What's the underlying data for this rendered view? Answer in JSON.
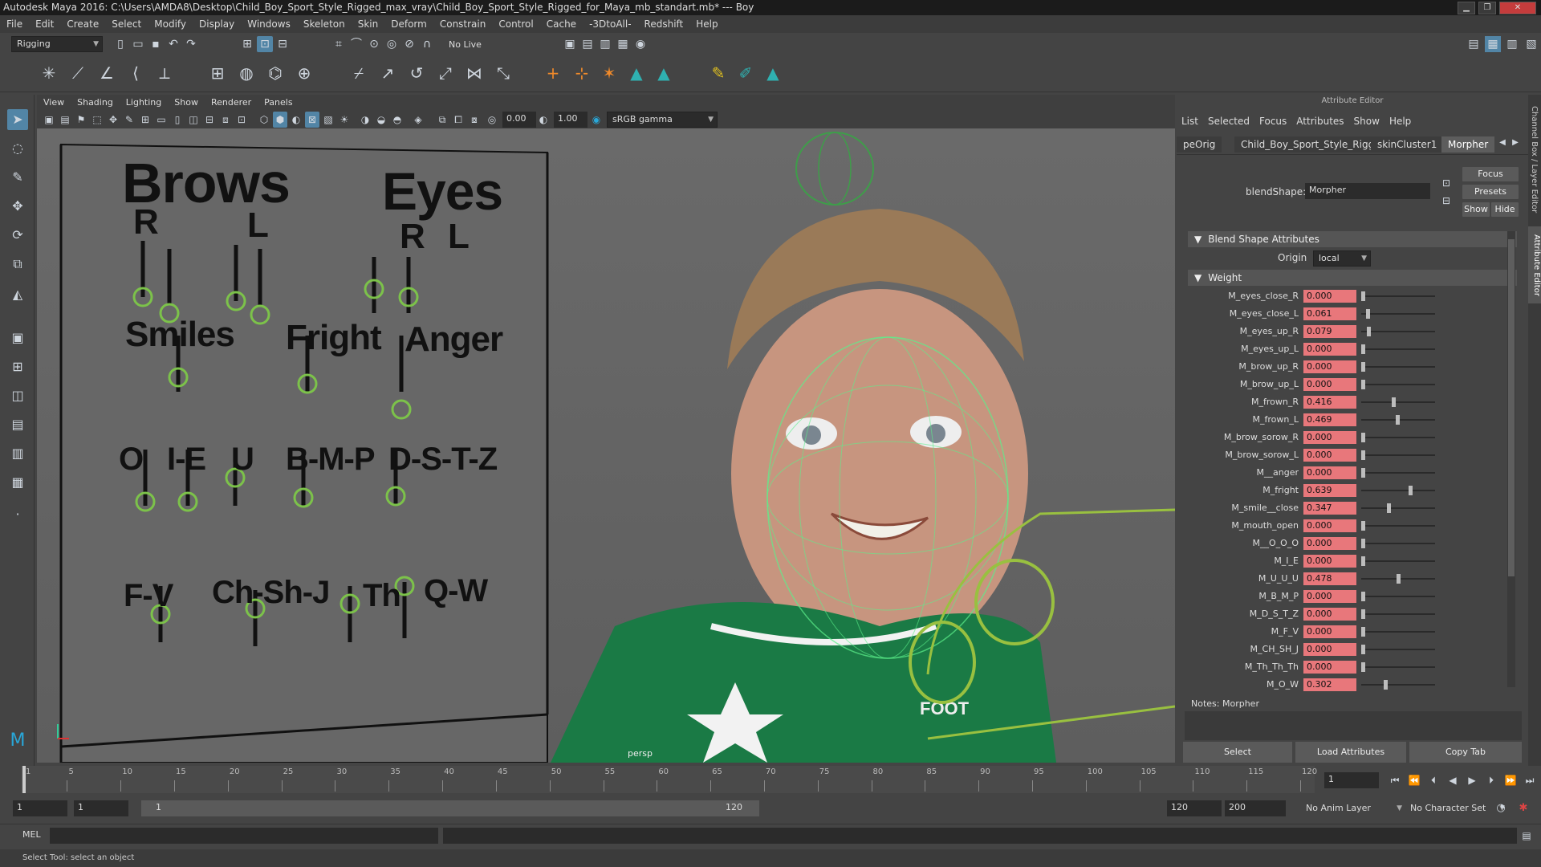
{
  "window": {
    "title": "Autodesk Maya 2016: C:\\Users\\AMDA8\\Desktop\\Child_Boy_Sport_Style_Rigged_max_vray\\Child_Boy_Sport_Style_Rigged_for_Maya_mb_standart.mb*  ---  Boy"
  },
  "menubar": [
    "File",
    "Edit",
    "Create",
    "Select",
    "Modify",
    "Display",
    "Windows",
    "Skeleton",
    "Skin",
    "Deform",
    "Constrain",
    "Control",
    "Cache",
    "-3DtoAll-",
    "Redshift",
    "Help"
  ],
  "status": {
    "mode": "Rigging",
    "live_surface": "No Live Surface"
  },
  "viewport": {
    "menu": [
      "View",
      "Shading",
      "Lighting",
      "Show",
      "Renderer",
      "Panels"
    ],
    "exposure": "0.00",
    "gamma": "1.00",
    "color_space": "sRGB gamma",
    "camera": "persp",
    "board_labels": {
      "brows": "Brows",
      "eyes": "Eyes",
      "r1": "R",
      "l1": "L",
      "r2": "R",
      "l2": "L",
      "smiles": "Smiles",
      "fright": "Fright",
      "anger": "Anger",
      "o": "O",
      "ie": "I-E",
      "u": "U",
      "bmp": "B-M-P",
      "dstz": "D-S-T-Z",
      "fv": "F-V",
      "chshj": "Ch-Sh-J",
      "th": "Th",
      "qw": "Q-W"
    },
    "jersey_text": "FOOT"
  },
  "attribute_editor": {
    "title": "Attribute Editor",
    "menu": [
      "List",
      "Selected",
      "Focus",
      "Attributes",
      "Show",
      "Help"
    ],
    "tabs": [
      "peOrig",
      "Child_Boy_Sport_Style_Rigged",
      "skinCluster1",
      "Morpher"
    ],
    "buttons": {
      "focus": "Focus",
      "presets": "Presets",
      "show": "Show",
      "hide": "Hide"
    },
    "blendshape_label": "blendShape:",
    "blendshape_value": "Morpher",
    "section_blend": "Blend Shape Attributes",
    "origin_label": "Origin",
    "origin_value": "local",
    "section_weight": "Weight",
    "weights": [
      {
        "name": "M_eyes_close_R",
        "value": "0.000",
        "v": 0.0
      },
      {
        "name": "M_eyes_close_L",
        "value": "0.061",
        "v": 0.061
      },
      {
        "name": "M_eyes_up_R",
        "value": "0.079",
        "v": 0.079
      },
      {
        "name": "M_eyes_up_L",
        "value": "0.000",
        "v": 0.0
      },
      {
        "name": "M_brow_up_R",
        "value": "0.000",
        "v": 0.0
      },
      {
        "name": "M_brow_up_L",
        "value": "0.000",
        "v": 0.0
      },
      {
        "name": "M_frown_R",
        "value": "0.416",
        "v": 0.416
      },
      {
        "name": "M_frown_L",
        "value": "0.469",
        "v": 0.469
      },
      {
        "name": "M_brow_sorow_R",
        "value": "0.000",
        "v": 0.0
      },
      {
        "name": "M_brow_sorow_L",
        "value": "0.000",
        "v": 0.0
      },
      {
        "name": "M__anger",
        "value": "0.000",
        "v": 0.0
      },
      {
        "name": "M_fright",
        "value": "0.639",
        "v": 0.639
      },
      {
        "name": "M_smile__close",
        "value": "0.347",
        "v": 0.347
      },
      {
        "name": "M_mouth_open",
        "value": "0.000",
        "v": 0.0
      },
      {
        "name": "M__O_O_O",
        "value": "0.000",
        "v": 0.0
      },
      {
        "name": "M_I_E",
        "value": "0.000",
        "v": 0.0
      },
      {
        "name": "M_U_U_U",
        "value": "0.478",
        "v": 0.478
      },
      {
        "name": "M_B_M_P",
        "value": "0.000",
        "v": 0.0
      },
      {
        "name": "M_D_S_T_Z",
        "value": "0.000",
        "v": 0.0
      },
      {
        "name": "M_F_V",
        "value": "0.000",
        "v": 0.0
      },
      {
        "name": "M_CH_SH_J",
        "value": "0.000",
        "v": 0.0
      },
      {
        "name": "M_Th_Th_Th",
        "value": "0.000",
        "v": 0.0
      },
      {
        "name": "M_O_W",
        "value": "0.302",
        "v": 0.302
      }
    ],
    "notes_label": "Notes:  Morpher",
    "bottom": {
      "select": "Select",
      "load": "Load Attributes",
      "copy": "Copy Tab"
    }
  },
  "side_tabs": {
    "channel": "Channel Box / Layer Editor",
    "attr": "Attribute Editor"
  },
  "timeline": {
    "ticks": [
      "1",
      "5",
      "10",
      "15",
      "20",
      "25",
      "30",
      "35",
      "40",
      "45",
      "50",
      "55",
      "60",
      "65",
      "70",
      "75",
      "80",
      "85",
      "90",
      "95",
      "100",
      "105",
      "110",
      "115",
      "120"
    ],
    "current": "1"
  },
  "range": {
    "start": "1",
    "start2": "1",
    "slider_start": "1",
    "slider_end": "120",
    "end": "120",
    "end2": "200",
    "anim_layer": "No Anim Layer",
    "char_set": "No Character Set"
  },
  "cmd": {
    "label": "MEL"
  },
  "help": "Select Tool: select an object"
}
